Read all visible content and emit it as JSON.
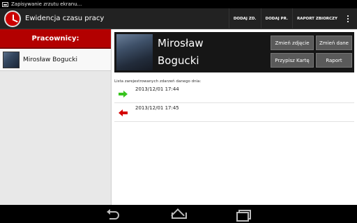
{
  "status_bar": {
    "notification": "Zapisywanie zrzutu ekranu..."
  },
  "action_bar": {
    "title": "Ewidencja czasu pracy",
    "buttons": [
      "DODAJ ZD.",
      "DODAJ PR.",
      "RAPORT ZBIORCZY"
    ]
  },
  "workers_panel": {
    "header": "Pracownicy:",
    "items": [
      {
        "name": "Mirosław Bogucki"
      }
    ]
  },
  "profile": {
    "first_name": "Mirosław",
    "last_name": "Bogucki",
    "buttons": [
      "Zmień zdjęcie",
      "Zmień dane",
      "Przypisz Kartę",
      "Raport"
    ]
  },
  "events": {
    "caption": "Lista zarejestrowanych zdarzeń danego dnia:",
    "items": [
      {
        "type": "entry",
        "time": "2013/12/01 17:44",
        "color": "#38c41f"
      },
      {
        "type": "exit",
        "time": "2013/12/01 17:45",
        "color": "#d40000"
      }
    ]
  },
  "colors": {
    "accent": "#b30000",
    "action_bar": "#222222",
    "button": "#5a5a5a"
  }
}
